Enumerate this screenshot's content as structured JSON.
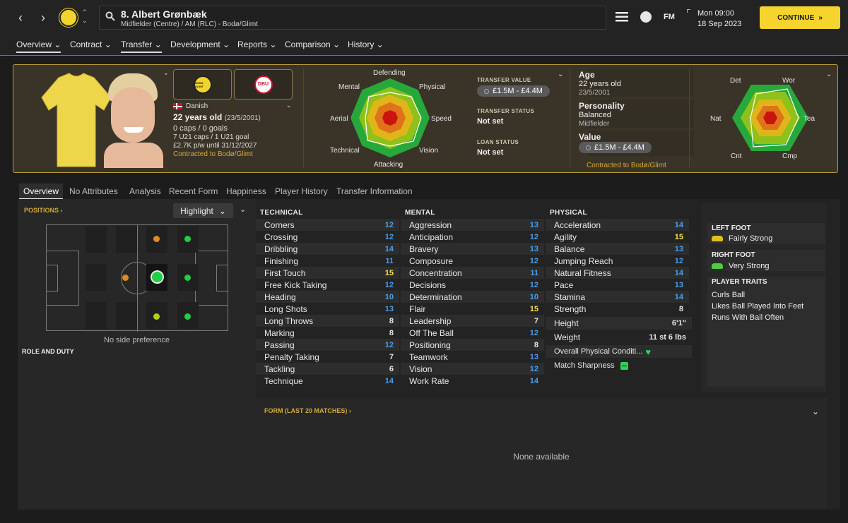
{
  "header": {
    "title": "8. Albert Grønbæk",
    "subtitle": "Midfielder (Centre) / AM (RLC) - Bodø/Glimt",
    "date_day": "Mon 09:00",
    "date_full": "18 Sep 2023",
    "continue_label": "CONTINUE",
    "fm_label": "FM"
  },
  "menu": [
    "Overview",
    "Contract",
    "Transfer",
    "Development",
    "Reports",
    "Comparison",
    "History"
  ],
  "player": {
    "nationality": "Danish",
    "age_line": "22 years old",
    "dob_paren": "(23/5/2001)",
    "caps": "0 caps / 0 goals",
    "u21": "7 U21 caps / 1 U21 goal",
    "wage": "£2.7K p/w until 31/12/2027",
    "contract": "Contracted to Bodø/Glimt",
    "club_badge_text": "BODØ GLIMT",
    "nation_badge_text": "DBU"
  },
  "radar": {
    "labels": [
      "Defending",
      "Physical",
      "Speed",
      "Vision",
      "Attacking",
      "Technical",
      "Aerial",
      "Mental"
    ]
  },
  "transfer": {
    "value_cap": "TRANSFER VALUE",
    "value": "£1.5M - £4.4M",
    "status_cap": "TRANSFER STATUS",
    "status": "Not set",
    "loan_cap": "LOAN STATUS",
    "loan": "Not set"
  },
  "info": {
    "age_label": "Age",
    "age": "22 years old",
    "dob": "23/5/2001",
    "personality_label": "Personality",
    "personality": "Balanced",
    "role": "Midfielder",
    "value_label": "Value",
    "value": "£1.5M - £4.4M",
    "contract": "Contracted to Bodø/Glimt"
  },
  "radar2": {
    "labels": [
      "Det",
      "Wor",
      "Tea",
      "Cmp",
      "Cnt",
      "Nat"
    ]
  },
  "tabs": [
    "Overview",
    "No Attributes",
    "Analysis",
    "Recent Form",
    "Happiness",
    "Player History",
    "Transfer Information"
  ],
  "positions": {
    "caption": "POSITIONS",
    "highlight": "Highlight",
    "side_pref": "No side preference",
    "role_caption": "ROLE AND DUTY"
  },
  "attributes": {
    "technical_header": "TECHNICAL",
    "mental_header": "MENTAL",
    "physical_header": "PHYSICAL",
    "technical": [
      {
        "name": "Corners",
        "value": "12"
      },
      {
        "name": "Crossing",
        "value": "12"
      },
      {
        "name": "Dribbling",
        "value": "14"
      },
      {
        "name": "Finishing",
        "value": "11"
      },
      {
        "name": "First Touch",
        "value": "15"
      },
      {
        "name": "Free Kick Taking",
        "value": "12"
      },
      {
        "name": "Heading",
        "value": "10"
      },
      {
        "name": "Long Shots",
        "value": "13"
      },
      {
        "name": "Long Throws",
        "value": "8"
      },
      {
        "name": "Marking",
        "value": "8"
      },
      {
        "name": "Passing",
        "value": "12"
      },
      {
        "name": "Penalty Taking",
        "value": "7"
      },
      {
        "name": "Tackling",
        "value": "6"
      },
      {
        "name": "Technique",
        "value": "14"
      }
    ],
    "mental": [
      {
        "name": "Aggression",
        "value": "13"
      },
      {
        "name": "Anticipation",
        "value": "12"
      },
      {
        "name": "Bravery",
        "value": "13"
      },
      {
        "name": "Composure",
        "value": "12"
      },
      {
        "name": "Concentration",
        "value": "11"
      },
      {
        "name": "Decisions",
        "value": "12"
      },
      {
        "name": "Determination",
        "value": "10"
      },
      {
        "name": "Flair",
        "value": "15"
      },
      {
        "name": "Leadership",
        "value": "7"
      },
      {
        "name": "Off The Ball",
        "value": "12"
      },
      {
        "name": "Positioning",
        "value": "8"
      },
      {
        "name": "Teamwork",
        "value": "13"
      },
      {
        "name": "Vision",
        "value": "12"
      },
      {
        "name": "Work Rate",
        "value": "14"
      }
    ],
    "physical": [
      {
        "name": "Acceleration",
        "value": "14"
      },
      {
        "name": "Agility",
        "value": "15"
      },
      {
        "name": "Balance",
        "value": "13"
      },
      {
        "name": "Jumping Reach",
        "value": "12"
      },
      {
        "name": "Natural Fitness",
        "value": "14"
      },
      {
        "name": "Pace",
        "value": "13"
      },
      {
        "name": "Stamina",
        "value": "14"
      },
      {
        "name": "Strength",
        "value": "8"
      }
    ],
    "height_label": "Height",
    "height": "6'1\"",
    "weight_label": "Weight",
    "weight": "11 st 6 lbs",
    "condition_label": "Overall Physical Conditi...",
    "sharpness_label": "Match Sharpness"
  },
  "feet": {
    "left_caption": "LEFT FOOT",
    "left": "Fairly Strong",
    "right_caption": "RIGHT FOOT",
    "right": "Very Strong",
    "traits_caption": "PLAYER TRAITS",
    "traits": [
      "Curls Ball",
      "Likes Ball Played Into Feet",
      "Runs With Ball Often"
    ]
  },
  "form": {
    "caption": "FORM (LAST 20 MATCHES)",
    "empty": "None available"
  },
  "colors": {
    "accent": "#f5d42e",
    "blue_value": "#4a9eea",
    "yellow_value": "#f2e14c"
  }
}
